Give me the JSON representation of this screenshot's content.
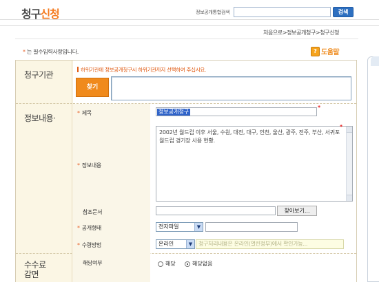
{
  "header": {
    "title_part1": "청구",
    "title_part2": "신청",
    "search_label": "정보공개통합검색",
    "search_placeholder": "",
    "search_button": "검색"
  },
  "breadcrumb": "처음으로>정보공개청구>청구신청",
  "required_note": {
    "star": "*",
    "text": "는 필수입력사항입니다."
  },
  "help": {
    "icon_glyph": "?",
    "label": "도움말"
  },
  "sections": {
    "agency": "청구기관",
    "info": "정보내용·",
    "fee": "수수료\n감면"
  },
  "agency": {
    "hint": "하위기관에 정보공개청구시 하위기관까지 선택하여 주십시요.",
    "find_button": "찾기",
    "value": ""
  },
  "form": {
    "star": "*",
    "title_label": "제목",
    "title_value": "정보공개청구",
    "content_label": "정보내용",
    "content_value": "2002년 월드컵 이후 서울, 수원, 대전, 대구, 인천, 울산, 광주, 전주, 부산, 서귀포 월드컵 경기장 사용 현황.",
    "reference_label": "참조문서",
    "reference_value": "",
    "browse_button": "찾아보기...",
    "format_label": "공개형태",
    "format_value": "전자파일",
    "method_label": "수령방법",
    "method_value": "온라인",
    "method_note": "청구처리내용은 온라인(열린정부)에서 확인가능..."
  },
  "fee": {
    "label": "해당여부",
    "option_yes": "해당",
    "option_no": "해당없음",
    "selected": "해당없음"
  },
  "colors": {
    "accent_orange": "#f08a1c",
    "button_blue": "#2d6fc0",
    "form_bg": "#fbf6e4",
    "required_red": "#e61e1e"
  }
}
